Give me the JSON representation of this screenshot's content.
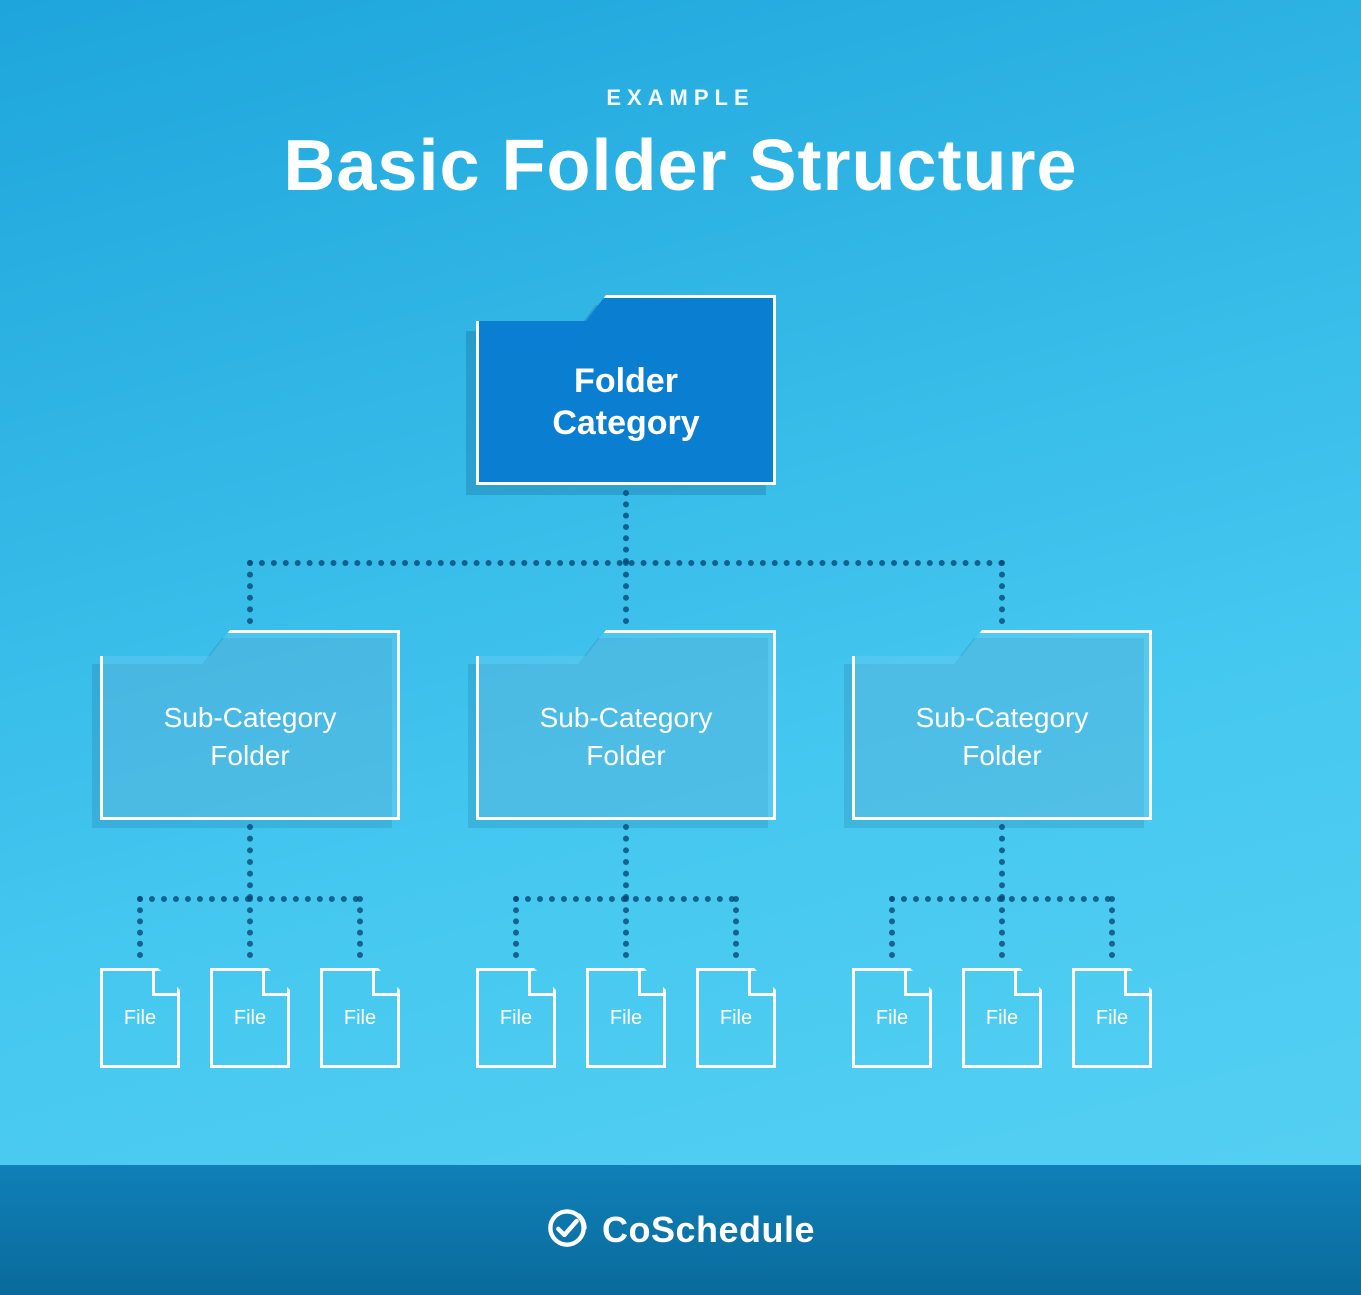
{
  "header": {
    "eyebrow": "EXAMPLE",
    "title": "Basic Folder Structure"
  },
  "root": {
    "label": "Folder\nCategory"
  },
  "subs": [
    {
      "label": "Sub-Category\nFolder"
    },
    {
      "label": "Sub-Category\nFolder"
    },
    {
      "label": "Sub-Category\nFolder"
    }
  ],
  "file_label": "File",
  "footer": {
    "brand": "CoSchedule"
  },
  "colors": {
    "bg_top": "#1ea5db",
    "bg_bottom": "#58d1f3",
    "root_fill": "#0a7ed1",
    "connector": "#0a4a78",
    "footer_top": "#0f80b8",
    "footer_bottom": "#0a6a9b"
  }
}
